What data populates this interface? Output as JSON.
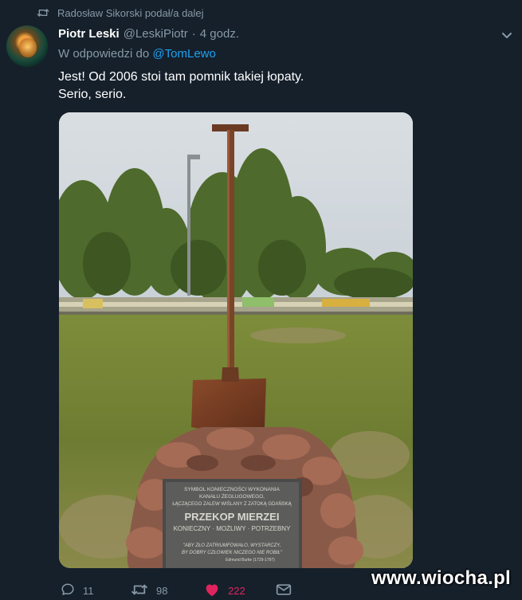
{
  "retweet": {
    "icon": "retweet-icon",
    "text": "Radosław Sikorski podał/a dalej"
  },
  "tweet": {
    "avatar_icon": "user-avatar",
    "author_name": "Piotr Leski",
    "author_handle": "@LeskiPiotr",
    "separator": "·",
    "time": "4 godz.",
    "reply_prefix": "W odpowiedzi do",
    "reply_mention": "@TomLewo",
    "text_lines": [
      "Jest! Od 2006 stoi tam pomnik takiej łopaty.",
      "Serio, serio."
    ],
    "menu_icon": "chevron-down-icon"
  },
  "media": {
    "plaque_lines": [
      "SYMBOL KONIECZNOŚCI WYKONANIA",
      "KANAŁU ŻEGLUGOWEGO,",
      "ŁĄCZĄCEGO ZALEW WIŚLANY Z ZATOKĄ GDAŃSKĄ",
      "PRZEKOP MIERZEI",
      "KONIECZNY · MOŻLIWY · POTRZEBNY",
      "\"ABY ZŁO ZATRIUMFOWAŁO, WYSTARCZY,",
      "BY DOBRY CZŁOWIEK NICZEGO NIE ROBIŁ\"",
      "Edmund Burke (1729-1797)"
    ]
  },
  "actions": {
    "reply_count": "11",
    "retweet_count": "98",
    "like_count": "222",
    "accent_like": "#e0245e",
    "accent_link": "#1da1f2"
  },
  "watermark": "www.wiocha.pl"
}
